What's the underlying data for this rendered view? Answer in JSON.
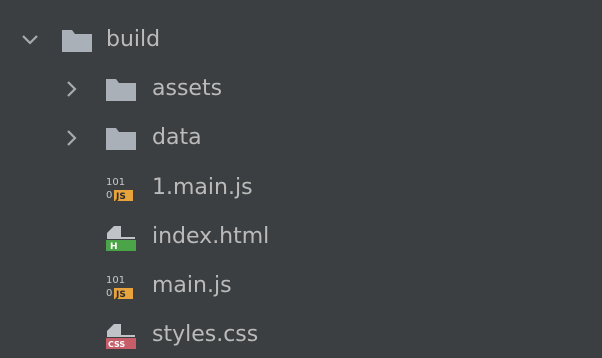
{
  "colors": {
    "background": "#3c3f41",
    "text": "#bbbbbb",
    "chevron": "#a7aaad",
    "folder": "#a9b0b8",
    "js_badge": "#e8a33d",
    "html_badge": "#4ba448",
    "css_badge": "#c75d68"
  },
  "tree": [
    {
      "label": "build",
      "type": "folder",
      "expanded": true,
      "icon": "folder-icon",
      "chevron": "chevron-down-icon"
    },
    {
      "label": "assets",
      "type": "folder",
      "expanded": false,
      "icon": "folder-icon",
      "chevron": "chevron-right-icon"
    },
    {
      "label": "data",
      "type": "folder",
      "expanded": false,
      "icon": "folder-icon",
      "chevron": "chevron-right-icon"
    },
    {
      "label": "1.main.js",
      "type": "file",
      "icon": "js-file-icon",
      "icon_text_top": "101",
      "icon_text_bottom": "0",
      "badge": "JS"
    },
    {
      "label": "index.html",
      "type": "file",
      "icon": "html-file-icon",
      "badge": "H"
    },
    {
      "label": "main.js",
      "type": "file",
      "icon": "js-file-icon",
      "icon_text_top": "101",
      "icon_text_bottom": "0",
      "badge": "JS"
    },
    {
      "label": "styles.css",
      "type": "file",
      "icon": "css-file-icon",
      "badge": "CSS"
    }
  ]
}
